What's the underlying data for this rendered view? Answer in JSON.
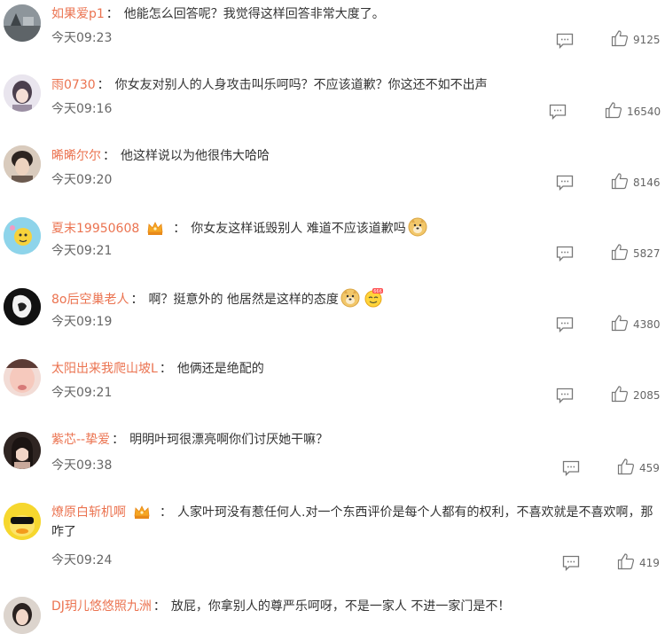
{
  "comments": [
    {
      "user": "如果爱p1",
      "text": "他能怎么回答呢？我觉得这样回答非常大度了。",
      "time": "今天09:23",
      "likes": "9125",
      "avatar": "avatar-icon"
    },
    {
      "user": "雨0730",
      "text": "你女友对别人的人身攻击叫乐呵吗？不应该道歉？你这还不如不出声",
      "time": "今天09:16",
      "likes": "16540",
      "avatar": "avatar-icon"
    },
    {
      "user": "晞晞尔尔",
      "text": "他这样说以为他很伟大哈哈",
      "time": "今天09:20",
      "likes": "8146",
      "avatar": "avatar-icon"
    },
    {
      "user": "夏末19950608",
      "text": "你女友这样诋毁别人 难道不应该道歉吗",
      "time": "今天09:21",
      "likes": "5827",
      "avatar": "avatar-icon",
      "badge": "crown-badge-icon",
      "emojis": [
        "doge-emoji"
      ]
    },
    {
      "user": "8o后空巢老人",
      "text": "啊？挺意外的 他居然是这样的态度",
      "time": "今天09:19",
      "likes": "4380",
      "avatar": "avatar-icon",
      "emojis": [
        "doge-emoji",
        "666-emoji"
      ]
    },
    {
      "user": "太阳出来我爬山坡L",
      "text": "他俩还是绝配的",
      "time": "今天09:21",
      "likes": "2085",
      "avatar": "avatar-icon"
    },
    {
      "user": "紫芯--挚爱",
      "text": "明明叶珂很漂亮啊你们讨厌她干嘛？",
      "time": "今天09:38",
      "likes": "459",
      "avatar": "avatar-icon"
    },
    {
      "user": "燎原白斩机啊",
      "text": "人家叶珂没有惹任何人.对一个东西评价是每个人都有的权利，不喜欢就是不喜欢啊，那咋了",
      "time": "今天09:24",
      "likes": "419",
      "avatar": "avatar-icon",
      "badge": "crown-badge-icon"
    },
    {
      "user": "DJ玥儿悠悠照九洲",
      "text": "放屁，你拿别人的尊严乐呵呀，不是一家人 不进一家门是不！",
      "avatar": "avatar-icon"
    }
  ],
  "colors": {
    "username": "#eb7350",
    "text": "#333333",
    "meta": "#666666"
  }
}
